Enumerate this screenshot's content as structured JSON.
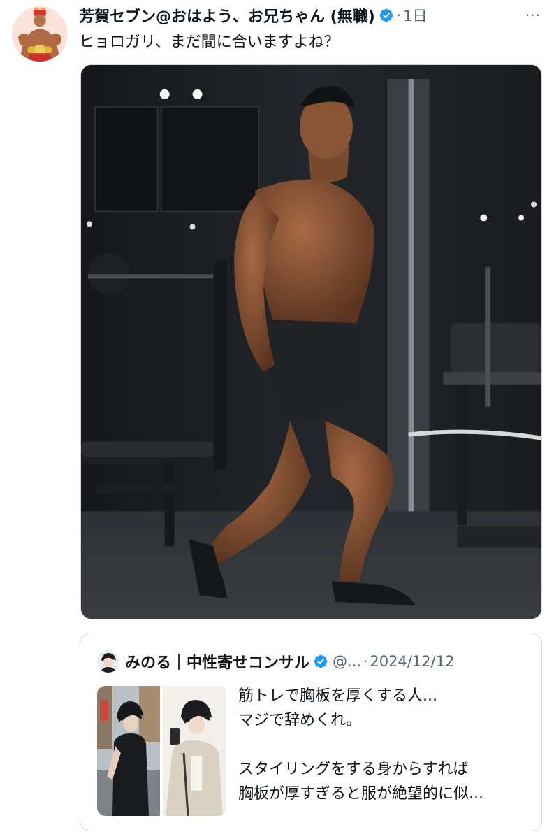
{
  "tweet": {
    "author_name": "芳賀セブン@おはよう、お兄ちゃん (無職)",
    "separator": "·",
    "time": "1日",
    "text": "ヒョロガリ、まだ間に合いますよね？",
    "more_label": "···",
    "icons": {
      "avatar": "profile-avatar",
      "verified": "verified-badge-icon",
      "more": "more-options-icon"
    }
  },
  "quote": {
    "author_name": "みのる｜中性寄せコンサル",
    "handle": "@...",
    "separator": "·",
    "date": "2024/12/12",
    "text_lines": [
      "筋トレで胸板を厚くする人...",
      "マジで辞めくれ。",
      "",
      "スタイリングをする身からすれば",
      "胸板が厚すぎると服が絶望的に似..."
    ]
  },
  "colors": {
    "text_primary": "#0f1419",
    "text_secondary": "#536471",
    "verified_blue": "#1d9bf0",
    "border": "#cfd9de"
  }
}
